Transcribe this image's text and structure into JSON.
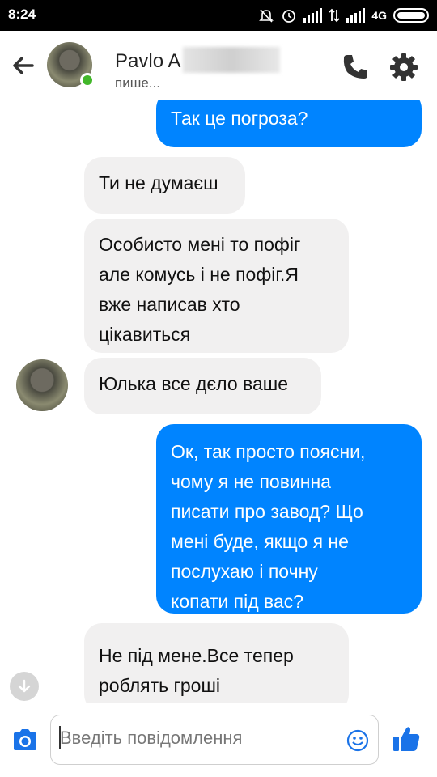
{
  "status_bar": {
    "time": "8:24",
    "network": "4G",
    "icons": [
      "mute-icon",
      "alarm-icon",
      "signal-icon",
      "data-icon",
      "signal-icon",
      "battery-icon"
    ]
  },
  "header": {
    "contact_name": "Pavlo A",
    "status": "пише...",
    "online": true,
    "icons": [
      "back-arrow-icon",
      "phone-icon",
      "gear-icon"
    ]
  },
  "messages": [
    {
      "direction": "outgoing",
      "text": "Так це погроза?"
    },
    {
      "direction": "incoming",
      "text": "Ти не думаєш"
    },
    {
      "direction": "incoming",
      "text": "Особисто мені то пофіг\nале комусь і не пофіг.Я\nвже написав хто\nцікавиться"
    },
    {
      "direction": "incoming",
      "text": "Юлька все дєло ваше"
    },
    {
      "direction": "outgoing",
      "text": "Ок, так просто поясни,\nчому я не повинна\nписати про завод? Що\nмені буде, якщо я не\nпослухаю і почну\nкопати під вас?"
    },
    {
      "direction": "incoming",
      "text": "Не під мене.Все тепер\nроблять гроші"
    }
  ],
  "composer": {
    "placeholder": "Введіть повідомлення",
    "icons": [
      "camera-icon",
      "emoji-icon",
      "thumbs-up-icon"
    ]
  },
  "colors": {
    "outgoing_bubble": "#0084ff",
    "incoming_bubble": "#f1f0f0",
    "accent": "#0084ff",
    "online": "#42b72a"
  }
}
